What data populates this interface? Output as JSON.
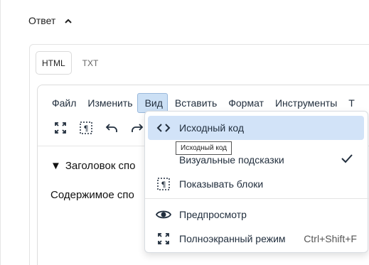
{
  "section": {
    "title": "Ответ"
  },
  "format_tabs": [
    {
      "label": "HTML",
      "active": true
    },
    {
      "label": "TXT",
      "active": false
    }
  ],
  "menubar": [
    {
      "label": "Файл"
    },
    {
      "label": "Изменить"
    },
    {
      "label": "Вид",
      "open": true
    },
    {
      "label": "Вставить"
    },
    {
      "label": "Формат"
    },
    {
      "label": "Инструменты"
    },
    {
      "label": "Т"
    }
  ],
  "toolbar": {
    "icons": [
      "fullscreen-icon",
      "show-blocks-icon",
      "undo-icon",
      "redo-icon"
    ]
  },
  "content": {
    "summary_marker": "▼",
    "summary_text": "Заголовок спо",
    "body_text": "Содержимое спо"
  },
  "view_menu": {
    "items": [
      {
        "label": "Исходный код",
        "icon": "source-code-icon",
        "highlighted": true
      },
      {
        "label": "Визуальные подсказки",
        "icon": "",
        "checked": true
      },
      {
        "label": "Показывать блоки",
        "icon": "show-blocks-icon"
      },
      {
        "label": "Предпросмотр",
        "icon": "preview-eye-icon"
      },
      {
        "label": "Полноэкранный режим",
        "icon": "fullscreen-icon",
        "shortcut": "Ctrl+Shift+F"
      }
    ]
  },
  "tooltip": {
    "text": "Исходный код"
  },
  "colors": {
    "highlight": "#d2e3f8",
    "menu_open": "#cce0f5",
    "text": "#222f3e"
  }
}
